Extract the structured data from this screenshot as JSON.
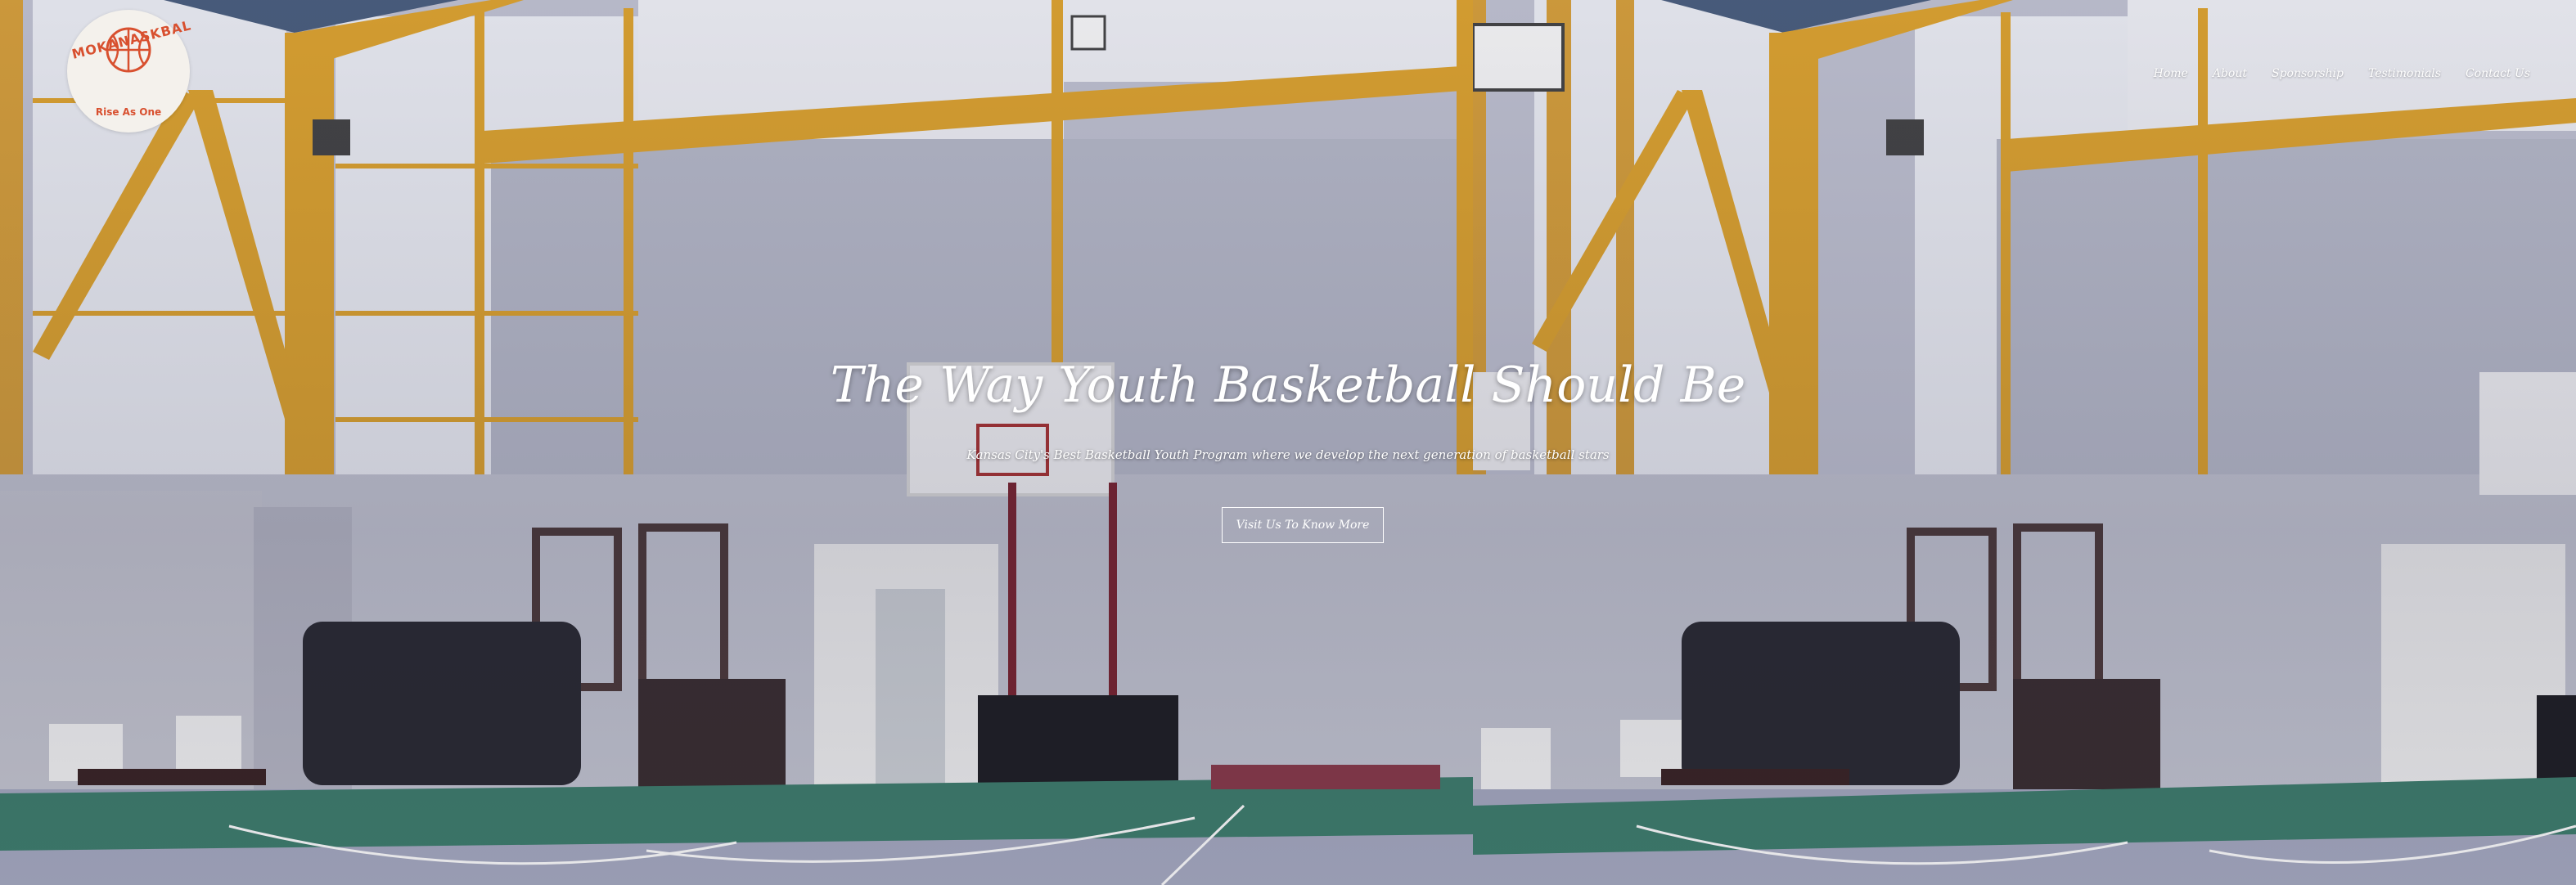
{
  "logo": {
    "brand_text": "MOKANASKBAL",
    "tagline": "Rise As One"
  },
  "nav": {
    "items": [
      {
        "label": "Home"
      },
      {
        "label": "About"
      },
      {
        "label": "Sponsorship"
      },
      {
        "label": "Testimonials"
      },
      {
        "label": "Contact Us"
      }
    ]
  },
  "hero": {
    "headline": "The Way Youth Basketball Should Be",
    "subline": "Kansas City's Best Basketball Youth Program where we develop the next generation of basketball stars",
    "cta_label": "Visit Us To Know More"
  },
  "colors": {
    "logo_red": "#d8502f",
    "beam_yellow": "#e0a52e",
    "wall": "#c3c5d2",
    "floor_green": "#3f7f6e"
  }
}
